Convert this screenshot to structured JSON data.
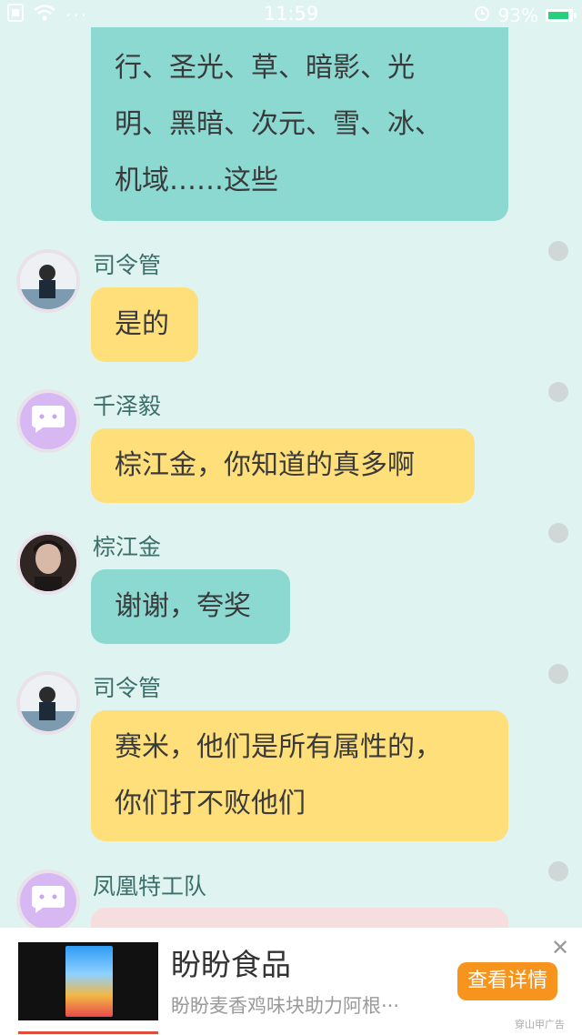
{
  "status_bar": {
    "time": "11:59",
    "battery": "93%"
  },
  "messages": [
    {
      "sender": "",
      "lines": [
        "行、圣光、草、暗影、光",
        "明、黑暗、次元、雪、冰、",
        "机域……这些"
      ],
      "color": "teal"
    },
    {
      "sender": "司令管",
      "lines": [
        "是的"
      ],
      "color": "yellow"
    },
    {
      "sender": "千泽毅",
      "lines": [
        "棕江金，你知道的真多啊"
      ],
      "color": "yellow"
    },
    {
      "sender": "棕江金",
      "lines": [
        "谢谢，夸奖"
      ],
      "color": "teal"
    },
    {
      "sender": "司令管",
      "lines": [
        "赛米，他们是所有属性的，",
        "你们打不败他们"
      ],
      "color": "yellow"
    },
    {
      "sender": "凤凰特工队",
      "lines": [],
      "color": "pink"
    }
  ],
  "ad": {
    "title": "盼盼食品",
    "subtitle": "盼盼麦香鸡味块助力阿根···",
    "button_label": "查看详情",
    "close_label": "✕",
    "source": "穿山甲广告"
  },
  "colors": {
    "background": "#dff3f1",
    "teal_bubble": "#8bd9d1",
    "yellow_bubble": "#fedf7a",
    "ad_button": "#f7941d"
  }
}
